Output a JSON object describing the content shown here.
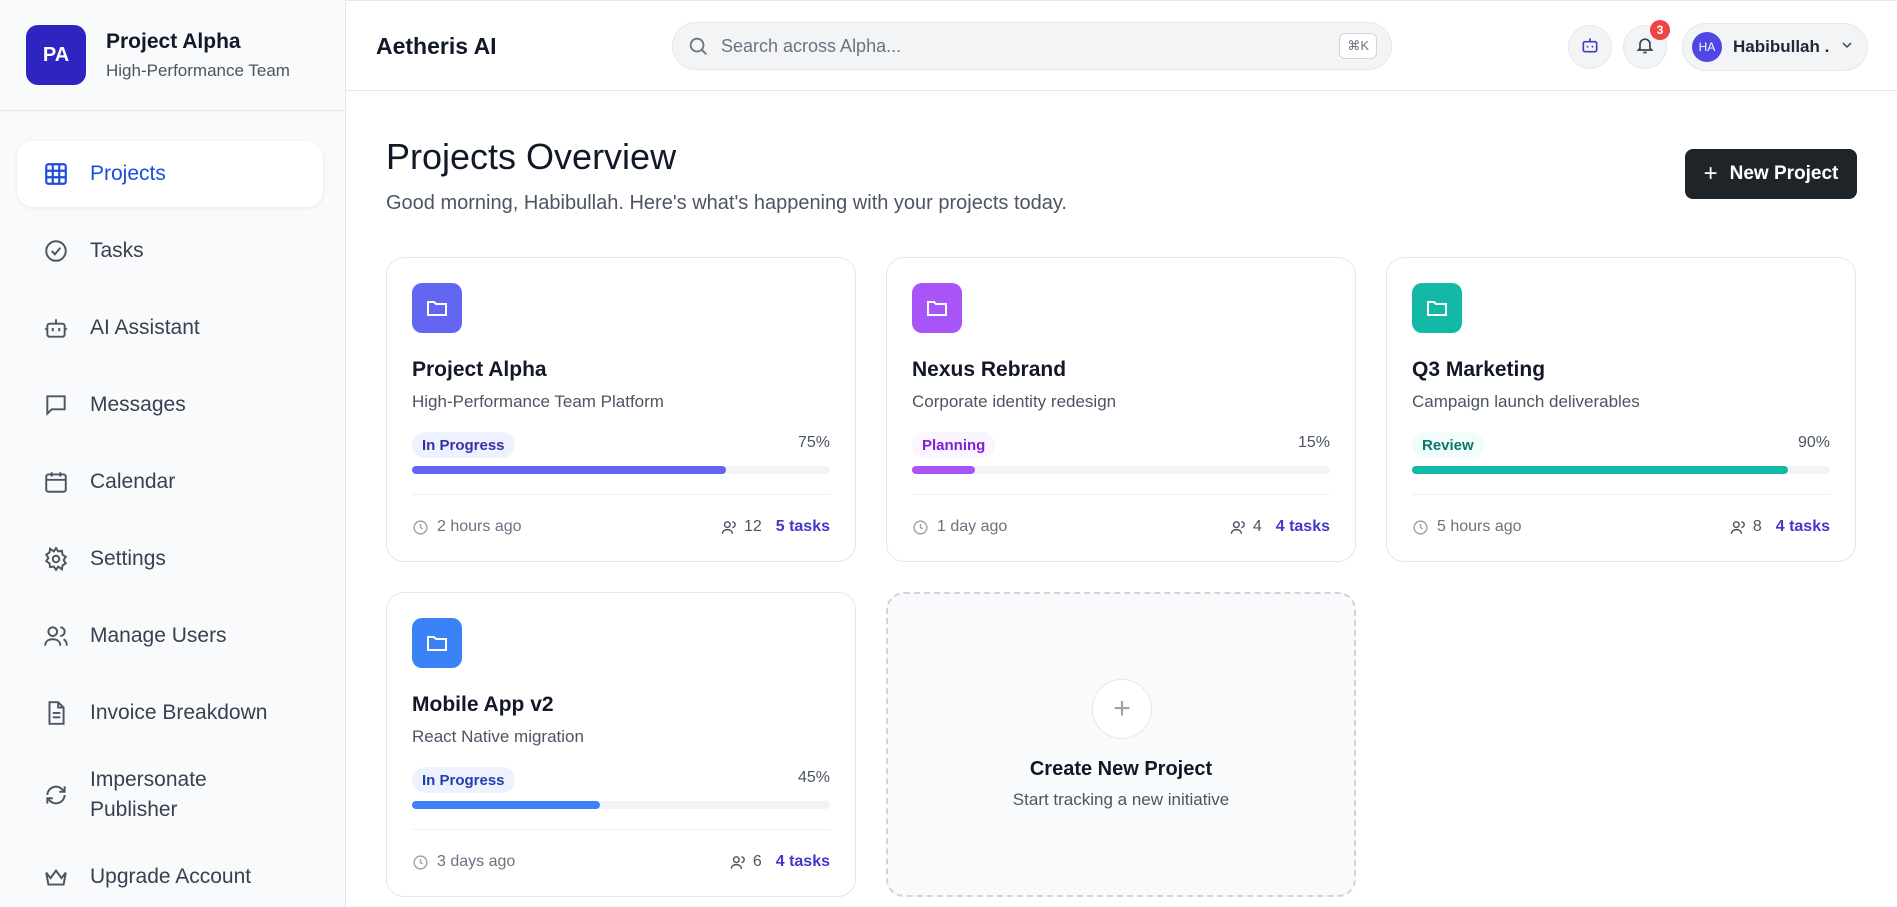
{
  "org": {
    "initials": "PA",
    "name": "Project Alpha",
    "subtitle": "High-Performance Team"
  },
  "sidebar": {
    "items": [
      {
        "label": "Projects",
        "icon": "grid-icon",
        "active": true
      },
      {
        "label": "Tasks",
        "icon": "check-circle-icon"
      },
      {
        "label": "AI Assistant",
        "icon": "bot-icon"
      },
      {
        "label": "Messages",
        "icon": "message-icon"
      },
      {
        "label": "Calendar",
        "icon": "calendar-icon"
      },
      {
        "label": "Settings",
        "icon": "gear-icon"
      },
      {
        "label": "Manage Users",
        "icon": "users-icon"
      },
      {
        "label": "Invoice Breakdown",
        "icon": "document-icon"
      },
      {
        "label": "Impersonate Publisher",
        "icon": "refresh-icon"
      },
      {
        "label": "Upgrade Account",
        "icon": "crown-icon"
      }
    ]
  },
  "topbar": {
    "brand": "Aetheris AI",
    "search_placeholder": "Search across Alpha...",
    "shortcut": "⌘K",
    "notification_count": "3",
    "user_initials": "HA",
    "user_name": "Habibullah ."
  },
  "main": {
    "title": "Projects Overview",
    "subtitle": "Good morning, Habibullah. Here's what's happening with your projects today.",
    "new_button": "New Project",
    "create_card": {
      "title": "Create New Project",
      "subtitle": "Start tracking a new initiative"
    }
  },
  "projects": [
    {
      "title": "Project Alpha",
      "desc": "High-Performance Team Platform",
      "status": "In Progress",
      "progress": 75,
      "progress_label": "75%",
      "updated": "2 hours ago",
      "members": "12",
      "tasks": "5 tasks",
      "color": "#6366f1",
      "status_bg": "#eef2ff",
      "status_fg": "#3730a3"
    },
    {
      "title": "Nexus Rebrand",
      "desc": "Corporate identity redesign",
      "status": "Planning",
      "progress": 15,
      "progress_label": "15%",
      "updated": "1 day ago",
      "members": "4",
      "tasks": "4 tasks",
      "color": "#a855f7",
      "status_bg": "#faf5ff",
      "status_fg": "#7e22ce"
    },
    {
      "title": "Q3 Marketing",
      "desc": "Campaign launch deliverables",
      "status": "Review",
      "progress": 90,
      "progress_label": "90%",
      "updated": "5 hours ago",
      "members": "8",
      "tasks": "4 tasks",
      "color": "#14b8a6",
      "status_bg": "#f0fdfa",
      "status_fg": "#0f766e"
    },
    {
      "title": "Mobile App v2",
      "desc": "React Native migration",
      "status": "In Progress",
      "progress": 45,
      "progress_label": "45%",
      "updated": "3 days ago",
      "members": "6",
      "tasks": "4 tasks",
      "color": "#3b82f6",
      "status_bg": "#eef2ff",
      "status_fg": "#1e40af"
    }
  ]
}
